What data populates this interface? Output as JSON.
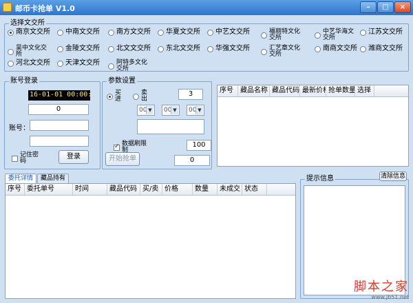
{
  "window": {
    "title": "邮币卡抢单 V1.0",
    "min": "–",
    "max": "□",
    "close": "×"
  },
  "exchange_group": {
    "label": "选择文交所",
    "options": [
      {
        "label": "南京文交所",
        "selected": true
      },
      {
        "label": "中南文交所"
      },
      {
        "label": "南方文交所"
      },
      {
        "label": "华夏文交所"
      },
      {
        "label": "中艺文交所"
      },
      {
        "label": "福丽特文化交所"
      },
      {
        "label": "中艺华海文交所"
      },
      {
        "label": "江苏文交所"
      },
      {
        "label": "吴中文化交所"
      },
      {
        "label": "金陵文交所"
      },
      {
        "label": "北文文交所"
      },
      {
        "label": "东北文交所"
      },
      {
        "label": "华强文交所"
      },
      {
        "label": "汇艺章文化交所"
      },
      {
        "label": "南商文交所"
      },
      {
        "label": "潍商文交所"
      },
      {
        "label": "河北文交所"
      },
      {
        "label": "天津文交所"
      },
      {
        "label": "阿特多文化交所"
      }
    ]
  },
  "account_group": {
    "label": "账号登录",
    "clock": "16-01-01 00:00:",
    "counter": "0",
    "account_label": "账号：",
    "account_value": "",
    "password_value": "",
    "remember_label": "记住密码",
    "login_button": "登录"
  },
  "params_group": {
    "label": "参数设置",
    "buy_label": "买进",
    "sell_label": "卖出",
    "qty": "3",
    "selects": [
      "00",
      "00",
      "00"
    ],
    "text_area": "",
    "limit_checkbox_label": "数据刷限制",
    "limit_value": "100",
    "start_button": "开始抢单",
    "start_count": "0"
  },
  "goods_table": {
    "columns": [
      "序号",
      "藏品名称",
      "藏品代码",
      "最新价格",
      "抢单数量",
      "选择"
    ]
  },
  "tabs": [
    {
      "label": "委托详情",
      "active": true
    },
    {
      "label": "藏品持有"
    }
  ],
  "orders_table": {
    "columns": [
      "序号",
      "委托单号",
      "时间",
      "藏品代码",
      "买/卖",
      "价格",
      "数量",
      "未成交",
      "状态"
    ]
  },
  "info_group": {
    "label": "提示信息",
    "clear_button": "清除信息"
  },
  "watermark": {
    "main": "脚本之家",
    "sub": "www.jb51.net"
  }
}
